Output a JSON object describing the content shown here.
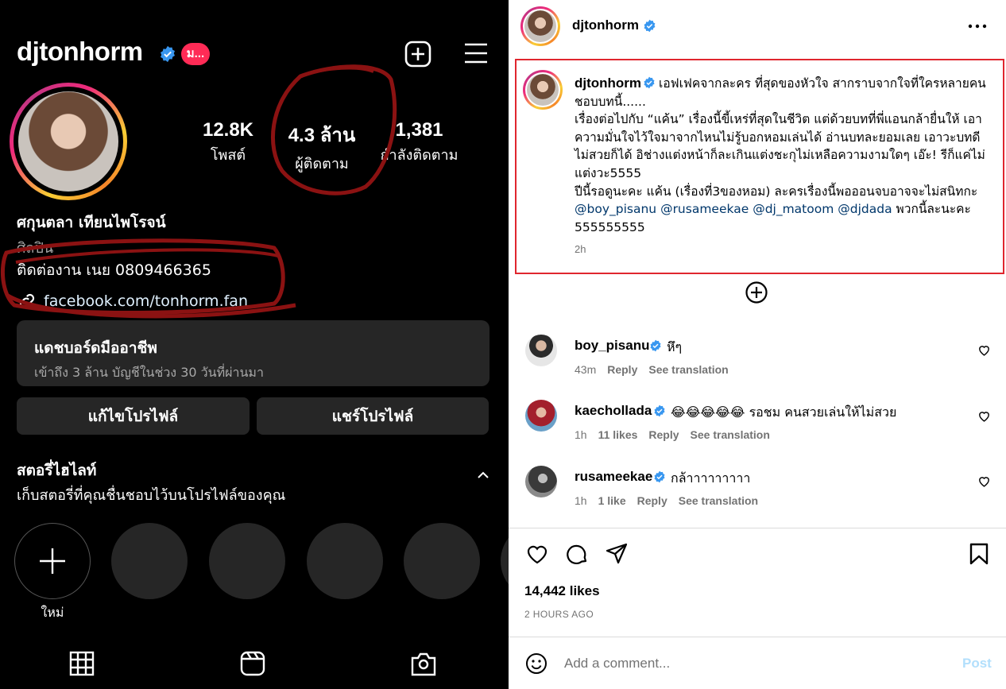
{
  "profile": {
    "username": "djtonhorm",
    "badge": "ม...",
    "stats": [
      {
        "value": "12.8K",
        "label": "โพสต์"
      },
      {
        "value": "4.3 ล้าน",
        "label": "ผู้ติดตาม"
      },
      {
        "value": "1,381",
        "label": "กำลังติดตาม"
      }
    ],
    "name": "ศกุนตลา เทียนไพโรจน์",
    "category": "ศิลปิน",
    "contact": "ติดต่องาน เนย 0809466365",
    "link": "facebook.com/tonhorm.fan",
    "dashboard_title": "แดชบอร์ดมืออาชีพ",
    "dashboard_sub": "เข้าถึง 3 ล้าน บัญชีในช่วง 30 วันที่ผ่านมา",
    "edit_button": "แก้ไขโปรไฟล์",
    "share_button": "แชร์โปรไฟล์",
    "highlights_title": "สตอรี่ไฮไลท์",
    "highlights_sub": "เก็บสตอรี่ที่คุณชื่นชอบไว้บนโปรไฟล์ของคุณ",
    "new_label": "ใหม่"
  },
  "post": {
    "username": "djtonhorm",
    "caption": {
      "p1": "เอฟเฟคจากละคร ที่สุดของหัวใจ สากราบจากใจที่ใครหลายคนชอบบทนี้......",
      "p2": "เรื่องต่อไปกับ “แค้น” เรื่องนี้ขี้เหร่ที่สุดในชีวิต แต่ด้วยบทที่พี่แอนกล้ายื่นให้ เอาความมั่นใจไว้ใจมาจากไหนไม่รู้บอกหอมเล่นได้ อ่านบทละยอมเลย เอาวะบทดีไม่สวยก็ได้ อิช่างแต่งหน้าก็ละเกินแต่งชะกุไม่เหลือความงามใดๆ เอ๊ะ! รีก็แค่ไม่แต่งวะ5555",
      "p3": "ปีนี้รอดูนะคะ แค้น (เรื่องที่3ของหอม) ละครเรื่องนี้พอออนจบอาจจะไม่สนิทกะ",
      "mentions": [
        "@boy_pisanu",
        "@rusameekae",
        "@dj_matoom",
        "@djdada"
      ],
      "tail": "พวกนี้ละนะคะ 555555555"
    },
    "time": "2h",
    "likes": "14,442 likes",
    "ago": "2 HOURS AGO",
    "comment_placeholder": "Add a comment...",
    "post_button": "Post"
  },
  "comments": [
    {
      "user": "boy_pisanu",
      "text": "หึๆ",
      "time": "43m",
      "likes": "",
      "reply": "Reply",
      "translate": "See translation"
    },
    {
      "user": "kaechollada",
      "text": "😂😂😂😂😂 รอชม คนสวยเล่นให้ไม่สวย",
      "time": "1h",
      "likes": "11 likes",
      "reply": "Reply",
      "translate": "See translation"
    },
    {
      "user": "rusameekae",
      "text": "กล้าาาาาาาาา",
      "time": "1h",
      "likes": "1 like",
      "reply": "Reply",
      "translate": "See translation"
    }
  ],
  "colors": {
    "verified": "#3897f0",
    "badge": "#ff2b56",
    "highlight_box": "#e0262e",
    "mention": "#00376b",
    "post_button": "#b2dffc"
  }
}
